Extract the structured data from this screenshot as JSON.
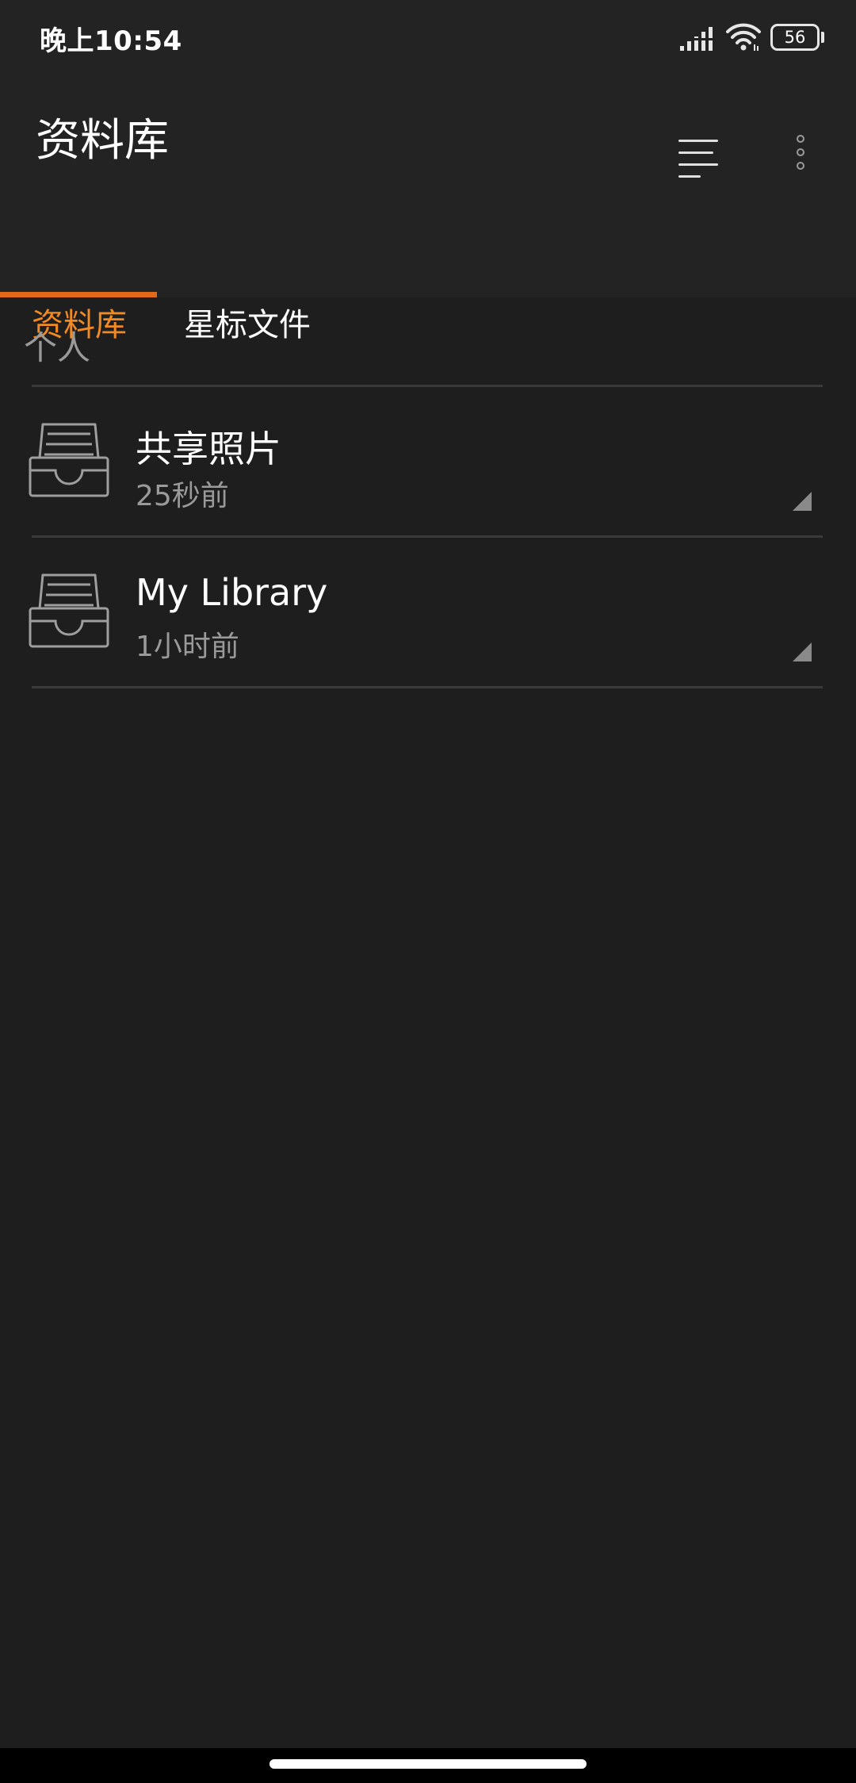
{
  "status_bar": {
    "time": "晚上10:54",
    "battery": "56",
    "icons": [
      "signal-icon",
      "wifi-icon",
      "battery-icon"
    ]
  },
  "header": {
    "title": "资料库",
    "actions": [
      "sort-icon",
      "more-vertical-icon"
    ]
  },
  "tabs": [
    {
      "label": "资料库",
      "active": true
    },
    {
      "label": "星标文件",
      "active": false
    }
  ],
  "colors": {
    "accent": "#f08a24",
    "indicator": "#e06a1a",
    "background": "#1e1e1e",
    "header_background": "#232323"
  },
  "section": {
    "title": "个人"
  },
  "libraries": [
    {
      "name": "共享照片",
      "updated": "25秒前",
      "icon": "inbox-tray-icon"
    },
    {
      "name": "My Library",
      "updated": "1小时前",
      "icon": "inbox-tray-icon"
    }
  ]
}
